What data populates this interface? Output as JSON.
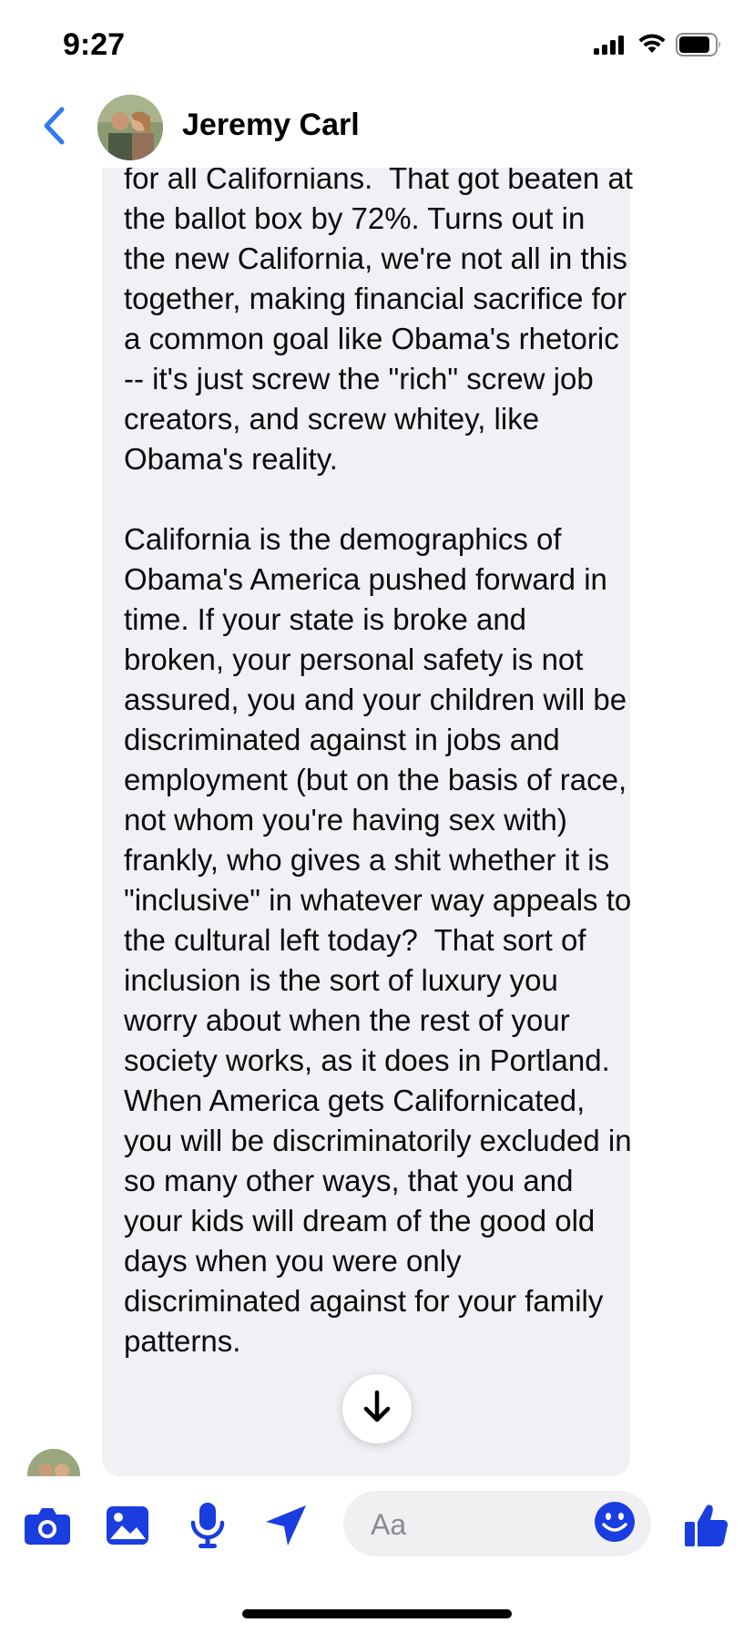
{
  "status_bar": {
    "time": "9:27"
  },
  "header": {
    "contact_name": "Jeremy Carl"
  },
  "message": {
    "paragraphs": [
      "for all Californians.  That got beaten at the ballot box by 72%. Turns out in the new California, we're not all in this together, making financial sacrifice for a common goal like Obama's rhetoric -- it's just screw the \"rich\" screw job creators, and screw whitey, like Obama's reality.",
      "California is the demographics of Obama's America pushed forward in time. If your state is broke and broken, your personal safety is not assured, you and your children will be discriminated against in jobs and employment (but on the basis of race, not whom you're having sex with) frankly, who gives a shit whether it is \"inclusive\" in whatever way appeals to the cultural left today?  That sort of inclusion is the sort of luxury you worry about when the rest of your society works, as it does in Portland. When America gets Californicated, you will be discriminatorily excluded in so many other ways, that you and your kids will dream of the good old days when you were only discriminated against for your family patterns."
    ]
  },
  "composer": {
    "placeholder": "Aa"
  },
  "colors": {
    "accent": "#1a3de0",
    "back_arrow": "#3478f6",
    "bubble_bg": "#f0f0f5"
  },
  "icons": {
    "back": "chevron-left-icon",
    "scroll_down": "arrow-down-icon",
    "camera": "camera-icon",
    "photo": "photo-icon",
    "mic": "microphone-icon",
    "location": "location-arrow-icon",
    "emoji": "smiley-icon",
    "like": "thumbs-up-icon"
  }
}
